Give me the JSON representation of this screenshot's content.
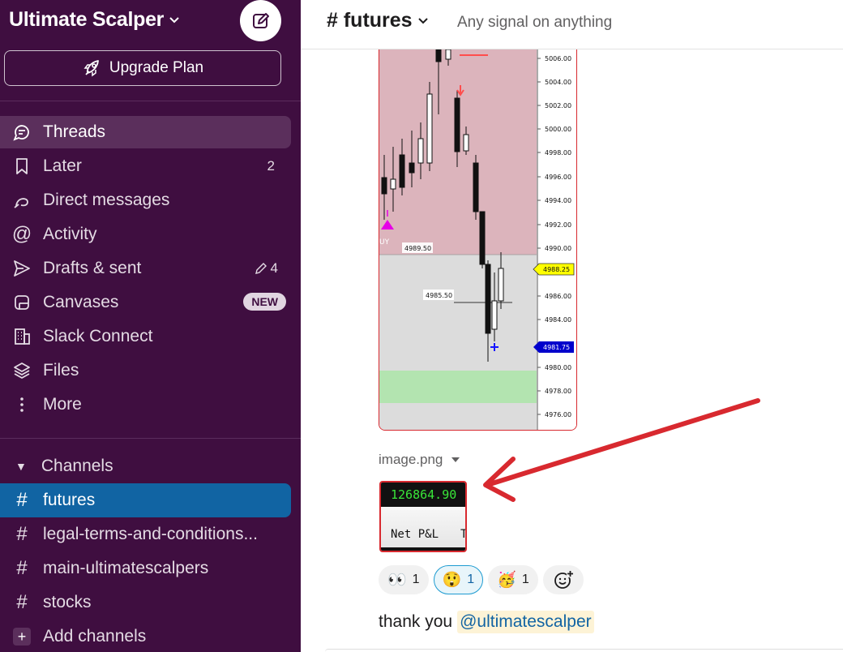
{
  "workspace": {
    "name": "Ultimate Scalper",
    "upgrade_label": "Upgrade Plan"
  },
  "nav": {
    "threads": "Threads",
    "later": "Later",
    "later_count": "2",
    "dms": "Direct messages",
    "activity": "Activity",
    "drafts": "Drafts & sent",
    "drafts_count": "4",
    "canvases": "Canvases",
    "canvases_badge": "NEW",
    "slack_connect": "Slack Connect",
    "files": "Files",
    "more": "More"
  },
  "channels": {
    "section_label": "Channels",
    "items": [
      "futures",
      "legal-terms-and-conditions...",
      "main-ultimatescalpers",
      "stocks"
    ],
    "add_label": "Add channels"
  },
  "header": {
    "channel": "futures",
    "topic": "Any signal on anything"
  },
  "chart": {
    "price_labels": [
      "5006.00",
      "5004.00",
      "5002.00",
      "5000.00",
      "4998.00",
      "4996.00",
      "4994.00",
      "4992.00",
      "4990.00",
      "4988.25",
      "4986.00",
      "4984.00",
      "4981.75",
      "4980.00",
      "4978.00",
      "4976.00"
    ],
    "level_a": "4989.50",
    "level_b": "4985.50",
    "buy_text": "UY",
    "current_price": "4988.25",
    "blue_price": "4981.75"
  },
  "attachment": {
    "file_name": "image.png",
    "pnl_value": "126864.90",
    "pnl_label": "Net P&L",
    "pnl_col": "T"
  },
  "reactions": [
    {
      "emoji": "👀",
      "count": "1"
    },
    {
      "emoji": "😲",
      "count": "1"
    },
    {
      "emoji": "🥳",
      "count": "1"
    }
  ],
  "message": {
    "text": "thank you",
    "mention": "@ultimatescalper"
  },
  "colors": {
    "sidebar": "#3f0e40",
    "selected": "#1164a3",
    "arrow": "#d8292f"
  }
}
